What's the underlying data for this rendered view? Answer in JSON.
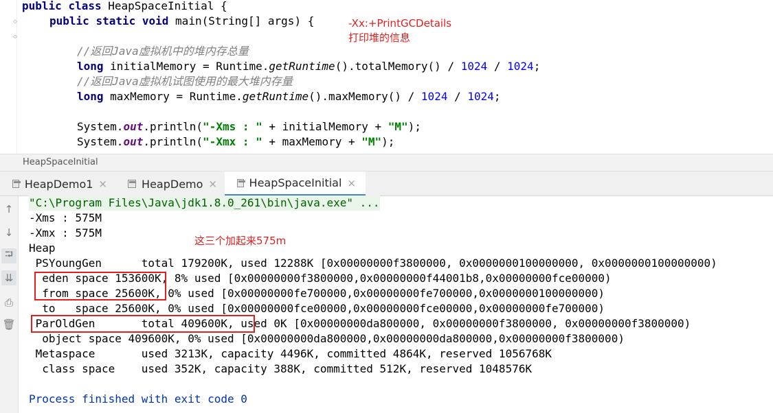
{
  "editor": {
    "lines": {
      "l1": {
        "kw1": "public",
        "kw2": "class",
        "name": "HeapSpaceInitial {"
      },
      "l2": {
        "kw1": "public",
        "kw2": "static",
        "kw3": "void",
        "rest": "main(String[] args) {"
      },
      "l3": {
        "comment": "//返回Java虚拟机中的堆内存总量"
      },
      "l4": {
        "type": "long",
        "pre": "initialMemory = Runtime.",
        "method": "getRuntime",
        "mid": "().totalMemory() / ",
        "num1": "1024",
        "div": " / ",
        "num2": "1024",
        "end": ";"
      },
      "l5": {
        "comment": "//返回Java虚拟机试图使用的最大堆内存量"
      },
      "l6": {
        "type": "long",
        "pre": "maxMemory = Runtime.",
        "method": "getRuntime",
        "mid": "().maxMemory() / ",
        "num1": "1024",
        "div": " / ",
        "num2": "1024",
        "end": ";"
      },
      "l7": {
        "cls": "System.",
        "field": "out",
        "call": ".println(",
        "str1": "\"-Xms : \"",
        "plus1": " + initialMemory + ",
        "str2": "\"M\"",
        "end": ");"
      },
      "l8": {
        "cls": "System.",
        "field": "out",
        "call": ".println(",
        "str1": "\"-Xmx : \"",
        "plus1": " + maxMemory + ",
        "str2": "\"M\"",
        "end": ");"
      }
    },
    "annotations": {
      "gc_flag": "-Xx:+PrintGCDetails",
      "gc_note": "打印堆的信息",
      "sum_note": "这三个加起来575m"
    }
  },
  "breadcrumb": {
    "label": "HeapSpaceInitial"
  },
  "run_tabs": [
    {
      "label": "HeapDemo1",
      "close": "×"
    },
    {
      "label": "HeapDemo",
      "close": "×"
    },
    {
      "label": "HeapSpaceInitial",
      "close": "×"
    }
  ],
  "console": {
    "toolbar": {
      "up": "↑",
      "down": "↓",
      "wrap": "⮒",
      "scroll_end": "⇊",
      "print": "⎙",
      "trash": "🗑"
    },
    "lines": [
      "\"C:\\Program Files\\Java\\jdk1.8.0_261\\bin\\java.exe\" ...",
      "-Xms : 575M",
      "-Xmx : 575M",
      "Heap",
      " PSYoungGen      total 179200K, used 12288K [0x00000000f3800000, 0x0000000100000000, 0x0000000100000000)",
      "  eden space 153600K, 8% used [0x00000000f3800000,0x00000000f44001b8,0x00000000fce00000)",
      "  from space 25600K, 0% used [0x00000000fe700000,0x00000000fe700000,0x0000000100000000)",
      "  to   space 25600K, 0% used [0x00000000fce00000,0x00000000fce00000,0x00000000fe700000)",
      " ParOldGen       total 409600K, used 0K [0x00000000da800000, 0x00000000f3800000, 0x00000000f3800000)",
      "  object space 409600K, 0% used [0x00000000da800000,0x00000000da800000,0x00000000f3800000)",
      " Metaspace       used 3213K, capacity 4496K, committed 4864K, reserved 1056768K",
      "  class space    used 352K, capacity 388K, committed 512K, reserved 1048576K",
      "",
      "Process finished with exit code 0"
    ]
  }
}
